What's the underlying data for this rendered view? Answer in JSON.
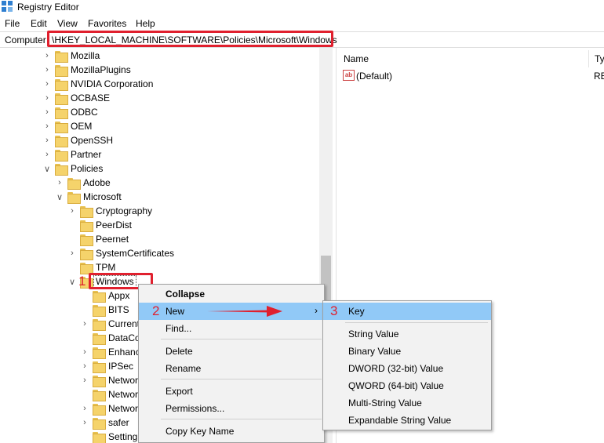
{
  "window": {
    "title": "Registry Editor"
  },
  "menu": [
    "File",
    "Edit",
    "View",
    "Favorites",
    "Help"
  ],
  "address": {
    "label": "Computer",
    "path": "\\HKEY_LOCAL_MACHINE\\SOFTWARE\\Policies\\Microsoft\\Windows"
  },
  "tree": [
    "Mozilla",
    "MozillaPlugins",
    "NVIDIA Corporation",
    "OCBASE",
    "ODBC",
    "OEM",
    "OpenSSH",
    "Partner",
    "Policies",
    "Adobe",
    "Microsoft",
    "Cryptography",
    "PeerDist",
    "Peernet",
    "SystemCertificates",
    "TPM",
    "Windows",
    "Appx",
    "BITS",
    "Current",
    "DataCo",
    "Enhanc",
    "IPSec",
    "Networ",
    "Networ",
    "Networ",
    "safer",
    "Setting"
  ],
  "values_pane": {
    "col_name": "Name",
    "col_type": "Ty",
    "row_name": "(Default)",
    "row_type": "RE"
  },
  "context_menu": [
    "Collapse",
    "New",
    "Find...",
    "Delete",
    "Rename",
    "Export",
    "Permissions...",
    "Copy Key Name"
  ],
  "new_submenu": [
    "Key",
    "String Value",
    "Binary Value",
    "DWORD (32-bit) Value",
    "QWORD (64-bit) Value",
    "Multi-String Value",
    "Expandable String Value"
  ],
  "annotations": {
    "step1": "1",
    "step2": "2",
    "step3": "3",
    "color": "#e0202e"
  },
  "colors": {
    "menu_highlight": "#91c9f7",
    "folder": "#f5d36b"
  }
}
